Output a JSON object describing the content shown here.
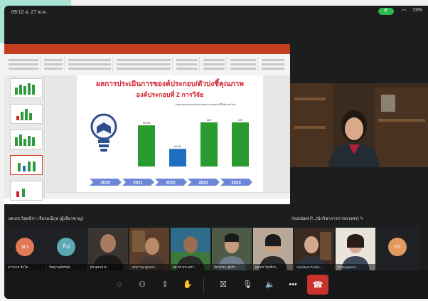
{
  "status_bar": {
    "time": "09:12  อ. 27 ต.ค.",
    "battery": "73%"
  },
  "slide": {
    "title_line1": "ผลการประเมินการของค์ประกอบ/ตัวบ่งชี้คุณภาพ",
    "title_line2": "องค์ประกอบที่ 2 การวิจัย",
    "note": "ร้อยละของผลงานทางวิชาการของอาจารย์ประจำที่ได้รับการอ้างอิง",
    "bar_labels": [
      "93.33",
      "40.00",
      "100",
      "100"
    ],
    "year_labels": [
      "2020",
      "2021",
      "2022",
      "2023",
      "2024"
    ],
    "colors": {
      "green": "#2a9b2f",
      "blue": "#1f6ec1",
      "year_pill": "#6e86d8"
    }
  },
  "shared_label": "ผศ.ดร.วิสุทธิกา เจียรมณีกุล (ผู้เชี่ยวชาญ)",
  "main_video_label": "Assistant P...(นักวิชาการการดวงพร) ✎",
  "strip": [
    {
      "initials": "ษว",
      "name": "ษวามาต ชิงโค...",
      "color": "#e07a55"
    },
    {
      "initials": "กิป",
      "name": "กิตญานต์ทรัพย์...",
      "color": "#5ba9b5"
    },
    {
      "initials": "",
      "name": "ดร.สุคนธ์ ช...",
      "color": ""
    },
    {
      "initials": "",
      "name": "กอบกาญ ซูเอลเว...",
      "color": ""
    },
    {
      "initials": "",
      "name": "ผศ.ดร.พระมหา...",
      "color": ""
    },
    {
      "initials": "",
      "name": "ติยวรรณ (ผู้เข้ร...",
      "color": ""
    },
    {
      "initials": "",
      "name": "ผศ.ดร.วิสุทธิกา...",
      "color": ""
    },
    {
      "initials": "",
      "name": "Assistant Profes...",
      "color": ""
    },
    {
      "initials": "",
      "name": "Participant K...",
      "color": ""
    },
    {
      "initials": "ปร",
      "name": "",
      "color": "#e39a5f"
    }
  ],
  "controls": [
    "chat-icon",
    "people-icon",
    "share-icon",
    "reactions-icon",
    "camera-off-icon",
    "mic-off-icon",
    "speaker-icon",
    "more-icon",
    "hang-up-icon"
  ]
}
